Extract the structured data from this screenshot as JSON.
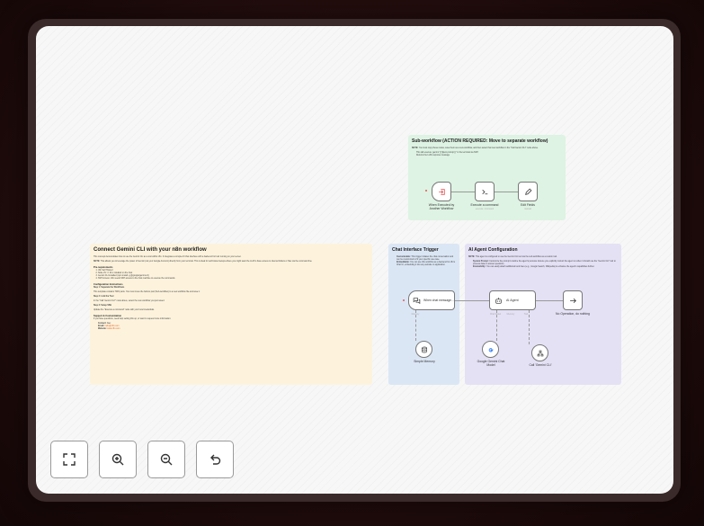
{
  "colors": {
    "yellow_note": "#fdf3dd",
    "green_note": "#def3e3",
    "blue_note": "#dbe6f5",
    "purple_note": "#e4e1f5",
    "accent": "#e0672b"
  },
  "subworkflow": {
    "title": "Sub-workflow (ACTION REQUIRED: Move to separate workflow)",
    "note_bold": "NOTE:",
    "note_text": "You must copy these nodes, save them as a new workflow, and then select that new workflow in the \"Call Gemini CLI\" node above.",
    "bullets": [
      "This will execute: gemini \"{{ $json.prompt }}\" in the terminal via SSH",
      "Returns the LLM response message"
    ],
    "nodes": {
      "trigger_label": "When Executed by Another Workflow",
      "exec_label": "Execute a command",
      "exec_sub": "execute: command",
      "edit_label": "Edit Fields",
      "edit_sub": "manual"
    }
  },
  "main_note": {
    "title": "Connect Gemini CLI with your n8n workflow",
    "intro": "This concept demonstrates how to use the Gemini CLI as a tool within n8n. It integrates a simple AI Chat interface with a backend CLI tool running on your server.",
    "note_bold": "NOTE:",
    "note_text": "This allows you to leverage the power of Gemini (via your Google Account) directly from your terminal. This is ideal for self-hosted setups where you might want the LLM to have access to internal folders or files via the command line.",
    "prereq_title": "Pre-requirements",
    "prereqs": [
      "n8n Self Hosted",
      "Node.JS >= 20.x installed on the host",
      "Gemini CLI installed (npm install -g @google/gemini-cli)",
      "SSH Access: n8n needs SSH access to the host machine to execute the commands."
    ],
    "config_title": "Configuration Instructions",
    "step1_title": "Step 1: Separate the Workflows",
    "step1_text": "This template contains TWO parts. You must move the bottom part (Sub-workflow) to a new workflow file and save it.",
    "step2_title": "Step 2: Link the Tool",
    "step2_text": "In the \"Call 'Gemini CLI'\" node above, select the new workflow you just saved.",
    "step3_title": "Step 3: Setup SSH",
    "step3_text": "Update the \"Execute a command\" node with your local credentials.",
    "support_title": "Support & Customization",
    "support_text": "If you have questions, need help setting this up, or want to request more information:",
    "contacts": [
      {
        "label": "Contact:",
        "value": "Alex"
      },
      {
        "label": "Email:",
        "value": "hello@n8n.com"
      },
      {
        "label": "Website:",
        "value": "www.n8n.com"
      }
    ]
  },
  "chat_note": {
    "title": "Chat Interface Trigger",
    "bullets": [
      {
        "bold": "Customizable:",
        "text": "This trigger initiates the chat conversation and can be customized to fit your specific use case."
      },
      {
        "bold": "Embeddable:",
        "text": "You can use this workflow as a backend for n8n's Chat UI, embedding it into any website or application."
      }
    ],
    "trigger_label": "When chat message...",
    "memory_label": "Simple Memory",
    "memory_port": "Memory"
  },
  "agent_note": {
    "title": "AI Agent Configuration",
    "note_bold": "NOTE:",
    "note_text": "This agent is configured to use the Gemini CLI tool via the sub-workflow as a custom tool.",
    "bullets": [
      {
        "bold": "System Prompt:",
        "text": "Customize the prompt to define the agent's persona. Ensure you explicitly instruct the agent on when it should use the \"Gemini CLI\" tool to process data or answer questions."
      },
      {
        "bold": "Extensibility:",
        "text": "You can easily attach additional tools here (e.g., Google Search, Wikipedia) to enhance the agent's capabilities further."
      }
    ],
    "agent_label": "AI Agent",
    "noop_label": "No Operation, do nothing",
    "model_label": "Google Gemini Chat Model",
    "tool_label": "Call 'Gemini CLI'",
    "port_model": "Chat Model",
    "port_memory": "Memory",
    "port_tool": "Tool"
  },
  "controls": {
    "fit": "fit-view",
    "zoom_in": "zoom-in",
    "zoom_out": "zoom-out",
    "reset": "reset-zoom"
  }
}
